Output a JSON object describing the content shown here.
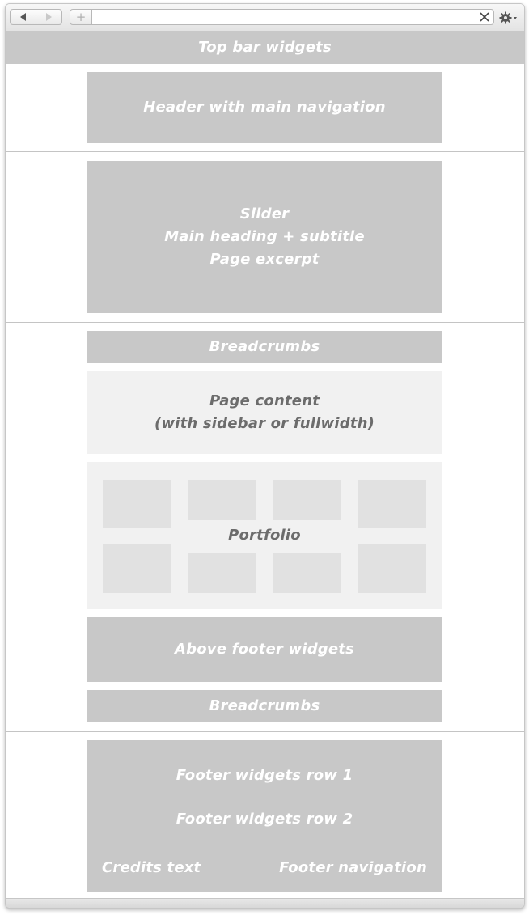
{
  "browser": {
    "address": "",
    "icons": [
      "back-icon",
      "forward-icon",
      "add-tab-icon",
      "clear-icon",
      "gear-icon"
    ]
  },
  "sections": {
    "topbar": "Top bar widgets",
    "header": "Header with main navigation",
    "slider": [
      "Slider",
      "Main heading + subtitle",
      "Page excerpt"
    ],
    "breadcrumbs_top": "Breadcrumbs",
    "page_content": [
      "Page content",
      "(with sidebar or fullwidth)"
    ],
    "portfolio": "Portfolio",
    "above_footer": "Above footer widgets",
    "breadcrumbs_bottom": "Breadcrumbs",
    "footer_row1": "Footer widgets row 1",
    "footer_row2": "Footer widgets row 2",
    "credits": "Credits text",
    "footer_nav": "Footer navigation"
  },
  "colors": {
    "block_dark": "#c8c8c8",
    "block_light": "#f1f1f1",
    "tile": "#e1e1e1",
    "label_light": "#ffffff",
    "label_dark": "#6c6c6c"
  }
}
